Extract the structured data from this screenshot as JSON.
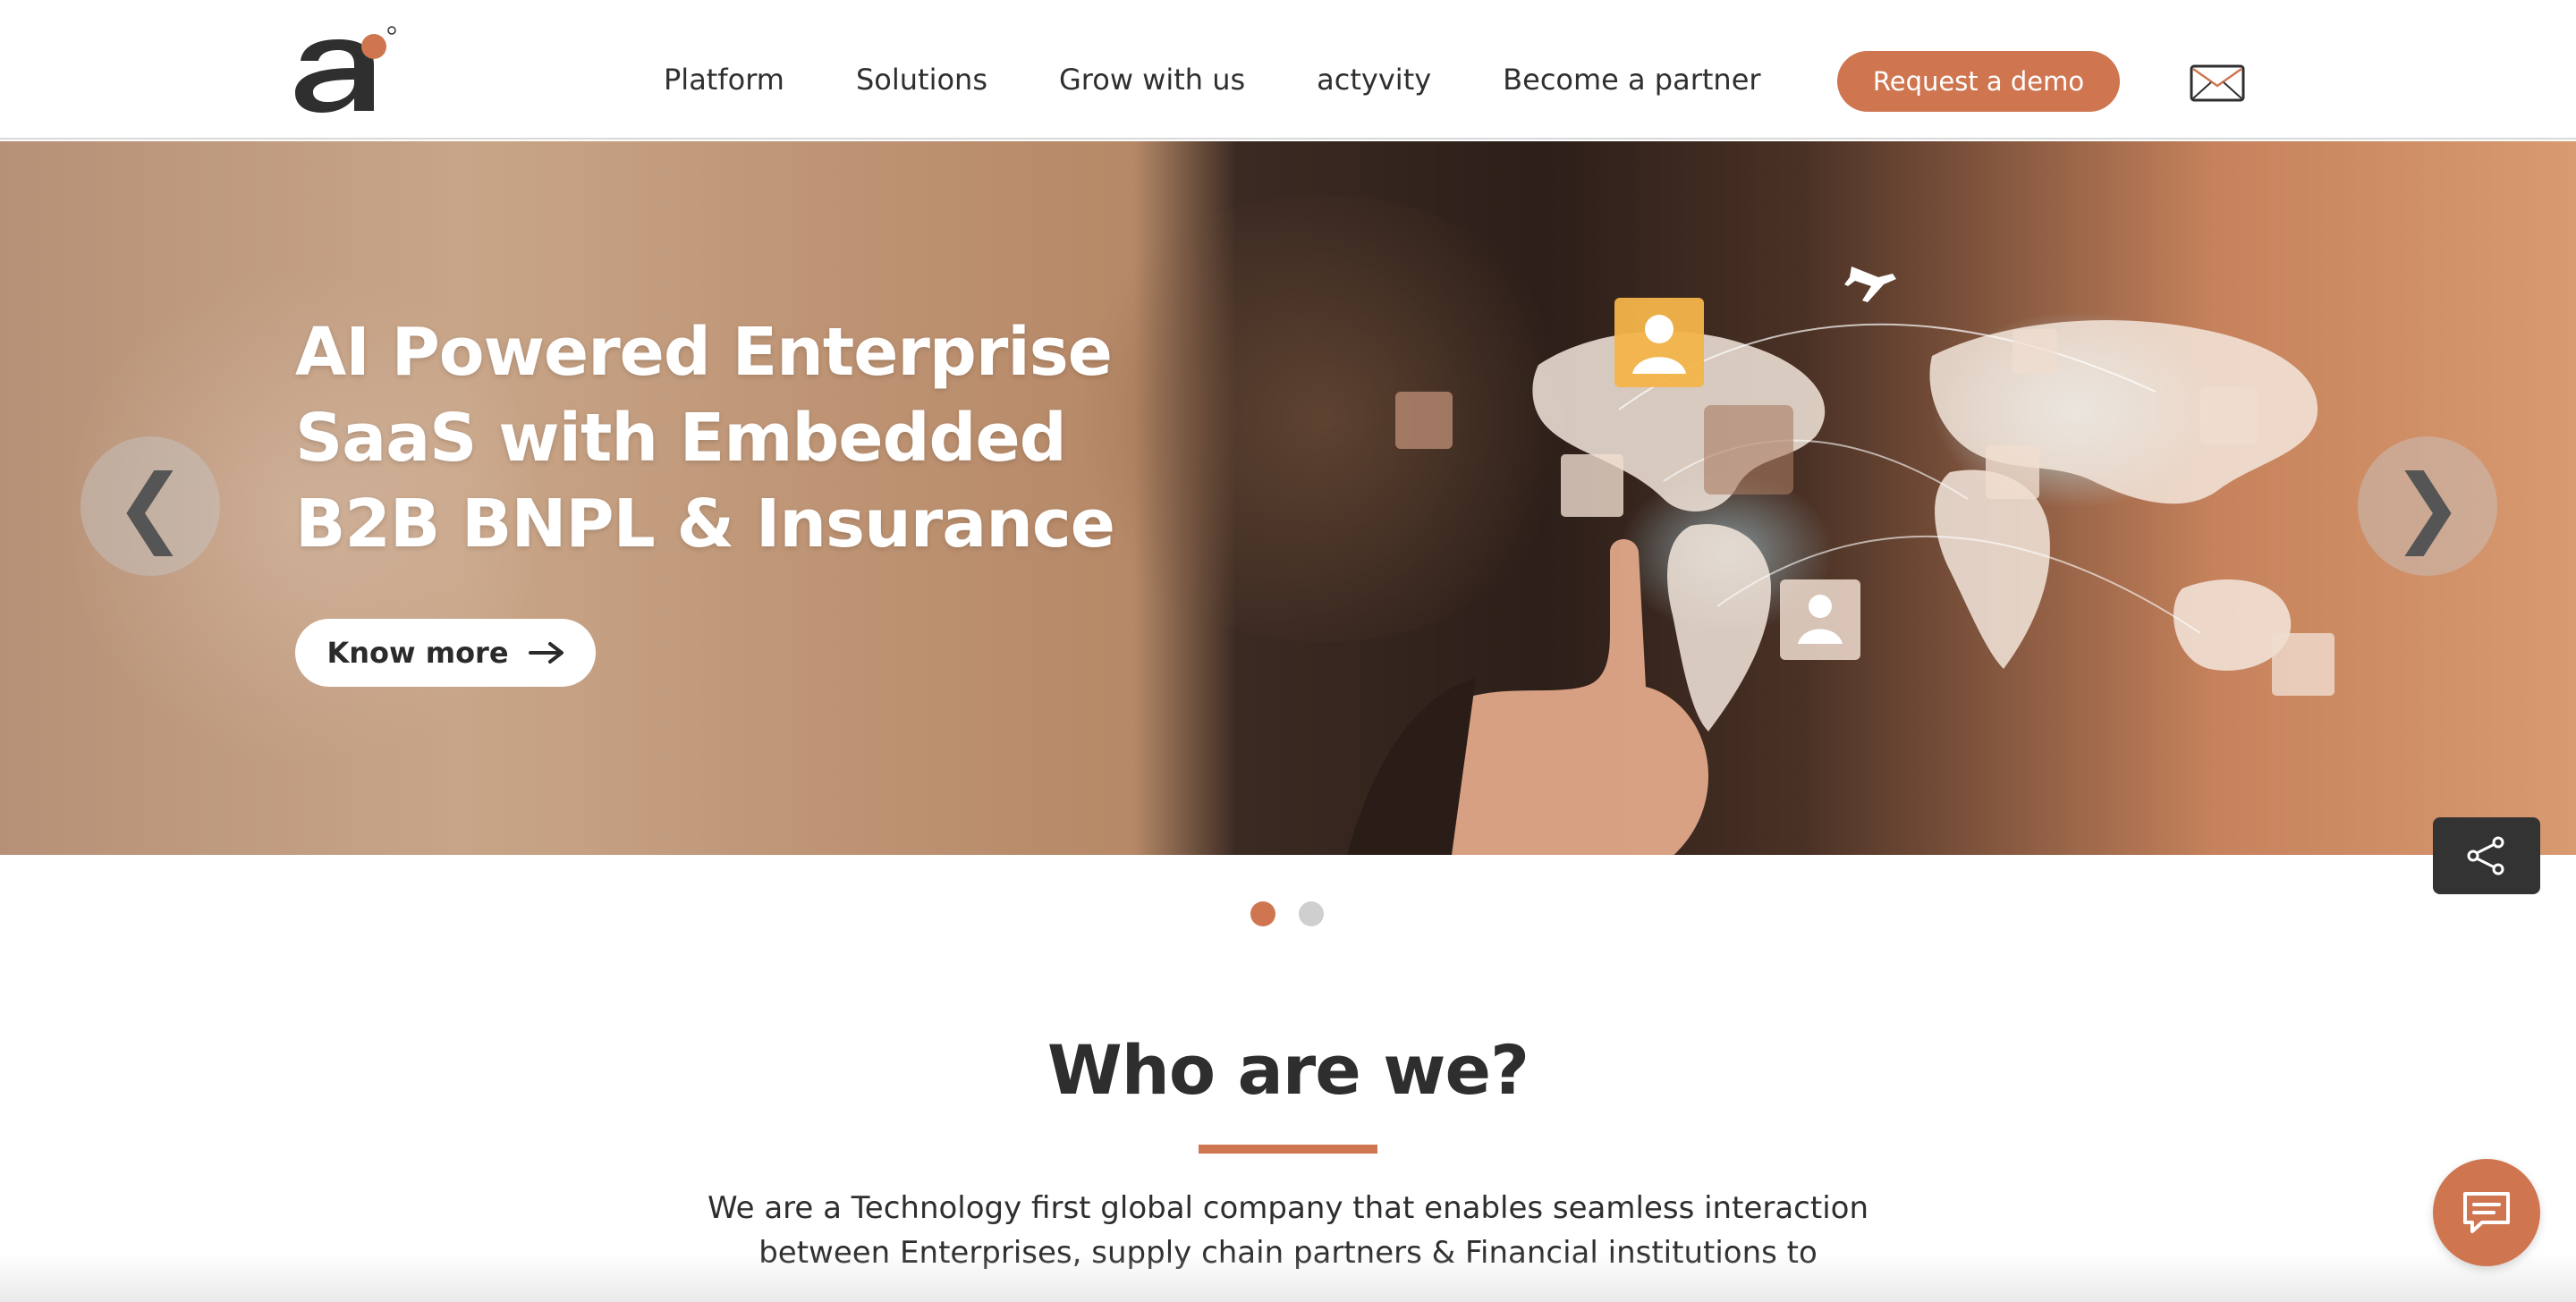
{
  "header": {
    "nav": [
      "Platform",
      "Solutions",
      "Grow with us",
      "actyvity",
      "Become a partner"
    ],
    "demo_button": "Request a demo"
  },
  "hero": {
    "title_lines": [
      "AI Powered Enterprise",
      "SaaS with Embedded",
      "B2B BNPL & Insurance"
    ],
    "cta": "Know more",
    "prev_arrow": "❮",
    "next_arrow": "❯",
    "slides_total": 2,
    "active_slide": 1
  },
  "about": {
    "title": "Who are we?",
    "text_lines": [
      "We are a Technology first global company that enables seamless interaction",
      "between Enterprises, supply chain partners & Financial institutions to"
    ]
  },
  "colors": {
    "accent": "#cf7651",
    "dark": "#2e2e2e",
    "share_bg": "#333333"
  },
  "icons": {
    "logo": "brand-logo",
    "mail": "mail-icon",
    "arrow": "arrow-right-icon",
    "share": "share-icon",
    "chat": "chat-icon"
  }
}
